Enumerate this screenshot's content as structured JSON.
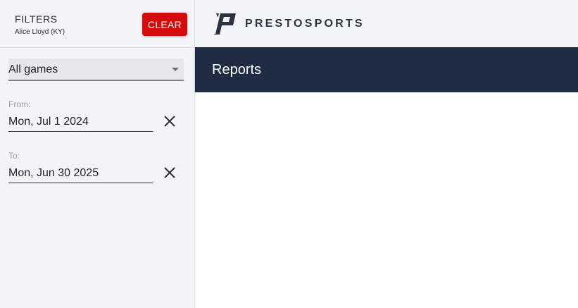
{
  "filters": {
    "title": "FILTERS",
    "subtitle": "Alice Lloyd (KY)",
    "clear_label": "CLEAR",
    "game_select": {
      "value": "All games"
    },
    "from": {
      "label": "From:",
      "value": "Mon, Jul 1 2024"
    },
    "to": {
      "label": "To:",
      "value": "Mon, Jun 30 2025"
    }
  },
  "header": {
    "brand": "PRESTOSPORTS",
    "logo_icon": "prestosports-logo-icon"
  },
  "page": {
    "title": "Reports"
  },
  "colors": {
    "accent_red": "#d40c0c",
    "navy_banner": "#1f2c44",
    "sidebar_bg": "#f3f4f7"
  }
}
